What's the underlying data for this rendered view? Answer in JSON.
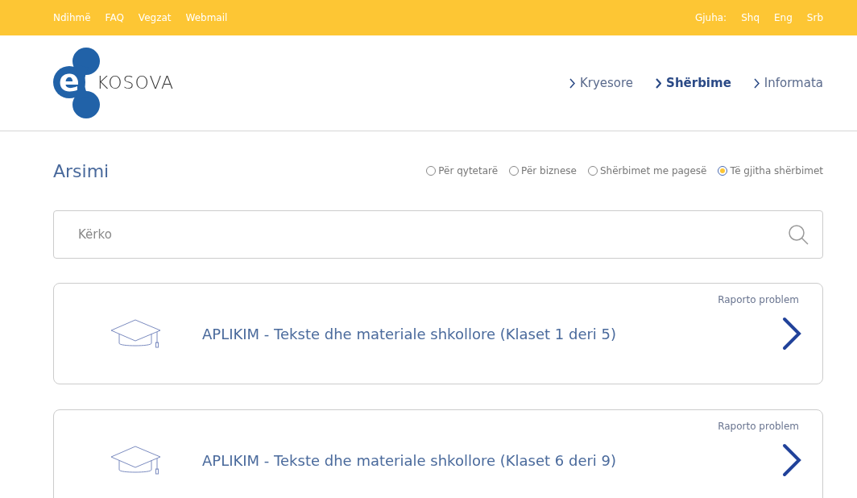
{
  "top_bar": {
    "links": [
      "Ndihmë",
      "FAQ",
      "Vegzat",
      "Webmail"
    ],
    "language_label": "Gjuha:",
    "languages": [
      "Shq",
      "Eng",
      "Srb"
    ]
  },
  "logo": {
    "letter": "e",
    "name": "KOSOVA"
  },
  "nav": [
    {
      "label": "Kryesore",
      "selected": false
    },
    {
      "label": "Shërbime",
      "selected": true
    },
    {
      "label": "Informata",
      "selected": false
    }
  ],
  "page_title": "Arsimi",
  "filters": [
    {
      "label": "Për qytetarë",
      "selected": false
    },
    {
      "label": "Për biznese",
      "selected": false
    },
    {
      "label": "Shërbimet me pagesë",
      "selected": false
    },
    {
      "label": "Të gjitha shërbimet",
      "selected": true
    }
  ],
  "search": {
    "placeholder": "Kërko"
  },
  "services": [
    {
      "title": "APLIKIM - Tekste dhe materiale shkollore (Klaset 1 deri 5)",
      "report": "Raporto problem"
    },
    {
      "title": "APLIKIM - Tekste dhe materiale shkollore (Klaset 6 deri 9)",
      "report": "Raporto problem"
    }
  ]
}
